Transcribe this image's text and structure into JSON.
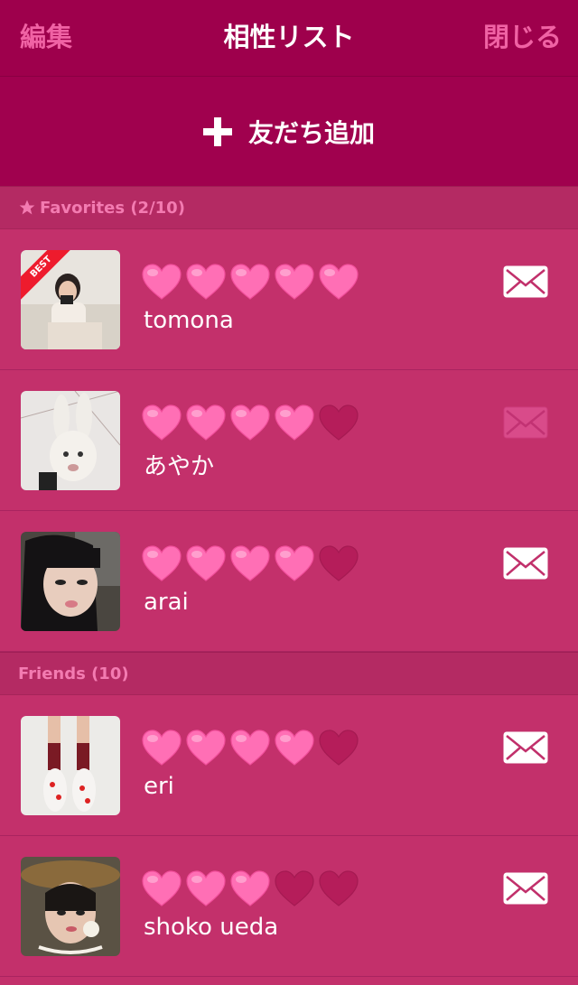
{
  "nav": {
    "left": "編集",
    "title": "相性リスト",
    "right": "閉じる"
  },
  "add": {
    "label": "友だち追加"
  },
  "sections": {
    "favorites": "Favorites (2/10)",
    "friends": "Friends (10)"
  },
  "badge": "BEST",
  "colors": {
    "heart_full": "#ff6fb5",
    "heart_empty": "#b51d5a",
    "accent": "#9e004c"
  },
  "favorites": [
    {
      "name": "tomona",
      "rating": 5,
      "mail_active": true,
      "best": true
    },
    {
      "name": "あやか",
      "rating": 4,
      "mail_active": false,
      "best": false
    },
    {
      "name": "arai",
      "rating": 4,
      "mail_active": true,
      "best": false
    }
  ],
  "friends": [
    {
      "name": "eri",
      "rating": 4,
      "mail_active": true,
      "best": false
    },
    {
      "name": "shoko ueda",
      "rating": 3,
      "mail_active": true,
      "best": false
    }
  ]
}
